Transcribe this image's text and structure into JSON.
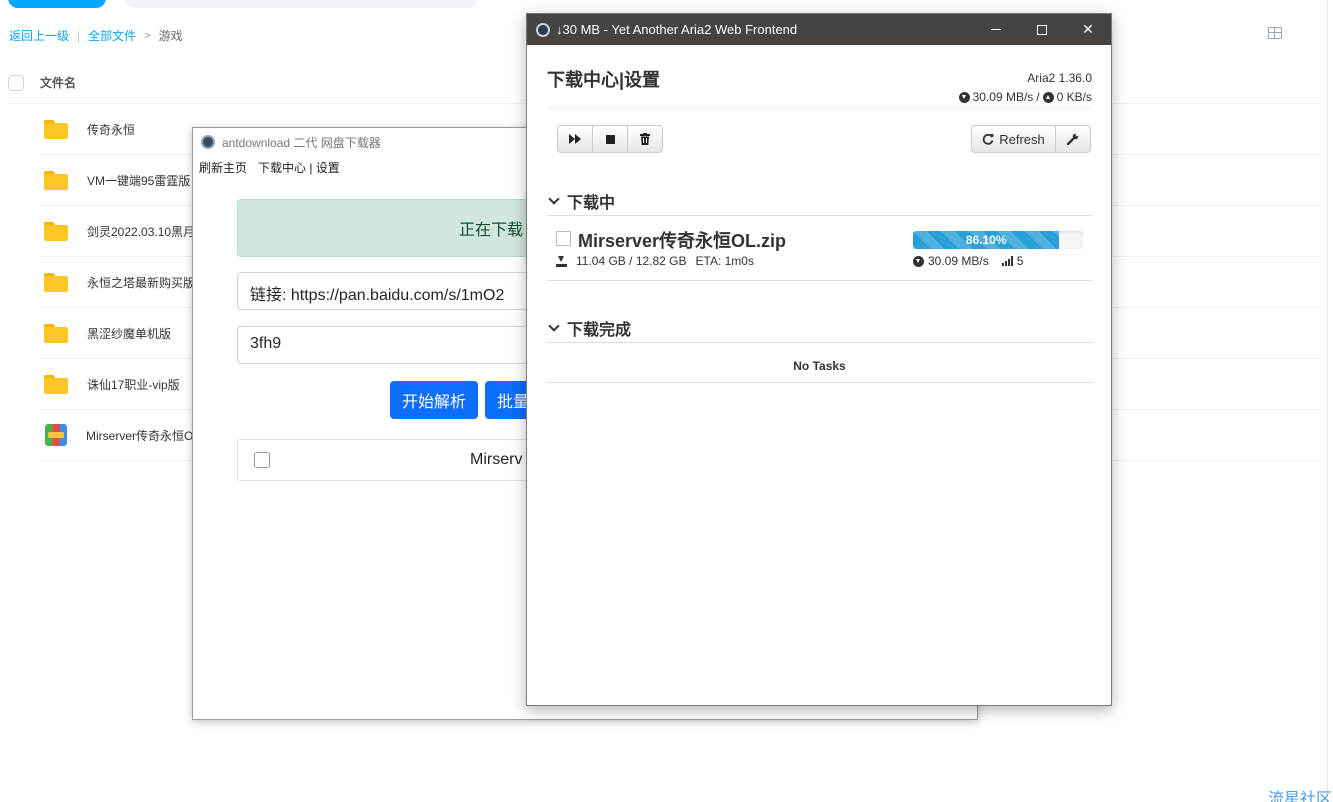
{
  "file_manager": {
    "breadcrumb": {
      "back": "返回上一级",
      "separator": "|",
      "all_files": "全部文件",
      "arrow": ">",
      "current": "游戏"
    },
    "column_header": "文件名",
    "files": [
      {
        "name": "传奇永恒",
        "icon": "folder-icon"
      },
      {
        "name": "VM一键端95雷霆版",
        "icon": "folder-icon"
      },
      {
        "name": "剑灵2022.03.10黑月",
        "icon": "folder-icon"
      },
      {
        "name": "永恒之塔最新购买版",
        "icon": "folder-icon"
      },
      {
        "name": "黑涩纱魔单机版",
        "icon": "folder-icon"
      },
      {
        "name": "诛仙17职业-vip版",
        "icon": "folder-icon"
      },
      {
        "name": "Mirserver传奇永恒O",
        "icon": "zip-archive-icon"
      }
    ]
  },
  "antdownload": {
    "title": "antdownload 二代 网盘下载器",
    "menu": [
      "刷新主页",
      "下载中心 | 设置"
    ],
    "status_alert": "正在下载",
    "link_field_value": "链接: https://pan.baidu.com/s/1mO2",
    "code_field_value": "3fh9",
    "parse_button": "开始解析",
    "batch_button": "批量",
    "file_row_name": "Mirserv"
  },
  "aria2": {
    "window_title": "↓30 MB - Yet Another Aria2 Web Frontend",
    "page_title": "下载中心|设置",
    "version": "Aria2 1.36.0",
    "download_speed": "30.09 MB/s",
    "speed_separator": "/",
    "upload_speed": "0 KB/s",
    "refresh_label": "Refresh",
    "section_active": "下载中",
    "section_completed": "下载完成",
    "task": {
      "name": "Mirserver传奇永恒OL.zip",
      "progress_label": "86.10%",
      "progress_fraction": 0.861,
      "size": "11.04 GB / 12.82 GB",
      "eta": "ETA: 1m0s",
      "speed": "30.09 MB/s",
      "connections": "5"
    },
    "no_tasks": "No Tasks"
  },
  "watermark": "流星社区",
  "colors": {
    "accent": "#06a7ff",
    "titlebar": "#474341",
    "progress": "#2a9fd6",
    "primary_button": "#0d6efd",
    "success_alert_bg": "#d1e7dd"
  }
}
